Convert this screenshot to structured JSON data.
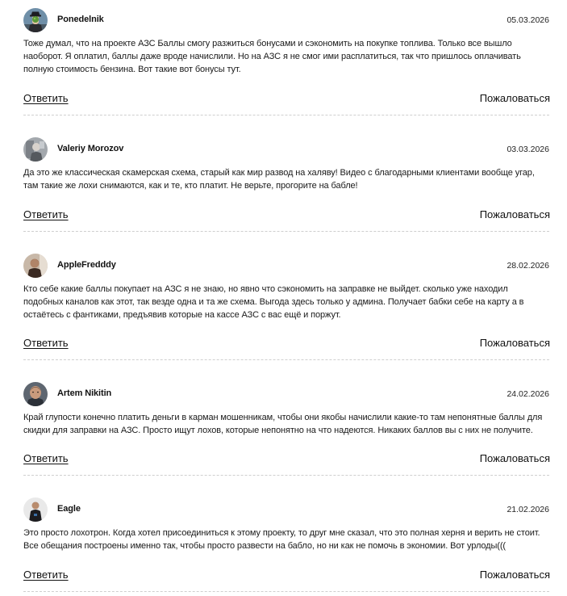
{
  "comments": [
    {
      "author": "Ponedelnik",
      "date": "05.03.2026",
      "avatar": "man-with-apple-painting-avatar",
      "text": "Тоже думал, что на проекте АЗС Баллы смогу разжиться бонусами и сэкономить на покупке топлива. Только все вышло наоборот. Я оплатил, баллы даже вроде начислили. Но на АЗС я не смог ими расплатиться, так что пришлось оплачивать полную стоимость бензина. Вот такие вот бонусы тут.",
      "reply_label": "Ответить",
      "report_label": "Пожаловаться"
    },
    {
      "author": "Valeriy Morozov",
      "date": "03.03.2026",
      "avatar": "grey-photo-avatar",
      "text": "Да это же классическая скамерская схема, старый как мир развод на халяву! Видео с благодарными клиентами вообще угар, там такие же лохи снимаются, как и те, кто платит. Не верьте, прогорите на бабле!",
      "reply_label": "Ответить",
      "report_label": "Пожаловаться"
    },
    {
      "author": "AppleFredddy",
      "date": "28.02.2026",
      "avatar": "man-portrait-avatar",
      "text": "Кто себе какие баллы покупает на АЗС я не знаю, но явно что сэкономить на заправке не выйдет. сколько уже находил подобных каналов как этот, так везде одна и та же схема. Выгода здесь только у админа. Получает бабки себе на карту а в остаётесь с фантиками, предъявив которые на кассе АЗС с вас ещё и поржут.",
      "reply_label": "Ответить",
      "report_label": "Пожаловаться"
    },
    {
      "author": "Artem Nikitin",
      "date": "24.02.2026",
      "avatar": "man-face-avatar",
      "text": "Край глупости конечно платить деньги в карман мошенникам, чтобы они якобы начислили какие-то там непонятные баллы для скидки для заправки на АЗС. Просто ищут лохов, которые непонятно на что надеются. Никаких баллов вы с них не получите.",
      "reply_label": "Ответить",
      "report_label": "Пожаловаться"
    },
    {
      "author": "Eagle",
      "date": "21.02.2026",
      "avatar": "figure-in-dark-jacket-avatar",
      "text": "Это просто лохотрон. Когда хотел присоединиться к этому проекту, то друг мне сказал, что это полная херня и верить не стоит. Все обещания построены именно так, чтобы просто развести на бабло, но ни как не помочь в экономии. Вот урлоды(((",
      "reply_label": "Ответить",
      "report_label": "Пожаловаться"
    }
  ]
}
